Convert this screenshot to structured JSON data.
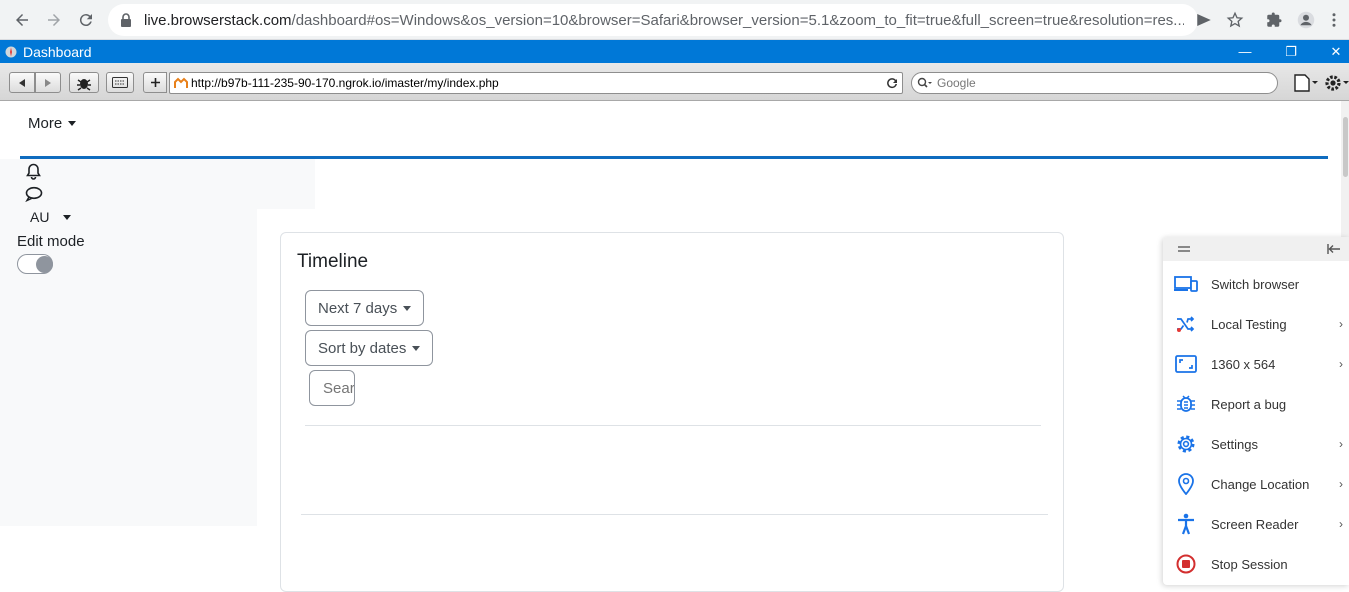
{
  "browser": {
    "url_host": "live.browserstack.com",
    "url_rest": "/dashboard#os=Windows&os_version=10&browser=Safari&browser_version=5.1&zoom_to_fit=true&full_screen=true&resolution=res..."
  },
  "window": {
    "title": "Dashboard",
    "minimize": "—",
    "maximize": "❐",
    "close": "✕"
  },
  "safari": {
    "address": "http://b97b-111-235-90-170.ngrok.io/imaster/my/index.php",
    "search_placeholder": "Google"
  },
  "page": {
    "more_label": "More",
    "user_initials": "AU",
    "edit_mode_label": "Edit mode",
    "timeline": {
      "title": "Timeline",
      "filter_label": "Next 7 days",
      "sort_label": "Sort by dates",
      "search_placeholder": "Search"
    }
  },
  "bs_menu": {
    "items": [
      {
        "label": "Switch browser",
        "icon": "devices-icon",
        "has_submenu": false
      },
      {
        "label": "Local Testing",
        "icon": "local-testing-icon",
        "has_submenu": true
      },
      {
        "label": "1360 x 564",
        "icon": "resolution-icon",
        "has_submenu": true
      },
      {
        "label": "Report a bug",
        "icon": "bug-icon",
        "has_submenu": false
      },
      {
        "label": "Settings",
        "icon": "gear-icon",
        "has_submenu": true
      },
      {
        "label": "Change Location",
        "icon": "location-pin-icon",
        "has_submenu": true
      },
      {
        "label": "Screen Reader",
        "icon": "accessibility-icon",
        "has_submenu": true
      },
      {
        "label": "Stop Session",
        "icon": "stop-icon",
        "has_submenu": false
      }
    ]
  },
  "colors": {
    "accent": "#0f6cbf",
    "window_title": "#0078d7",
    "bs_icon": "#1a73e8",
    "stop": "#d32f2f"
  }
}
